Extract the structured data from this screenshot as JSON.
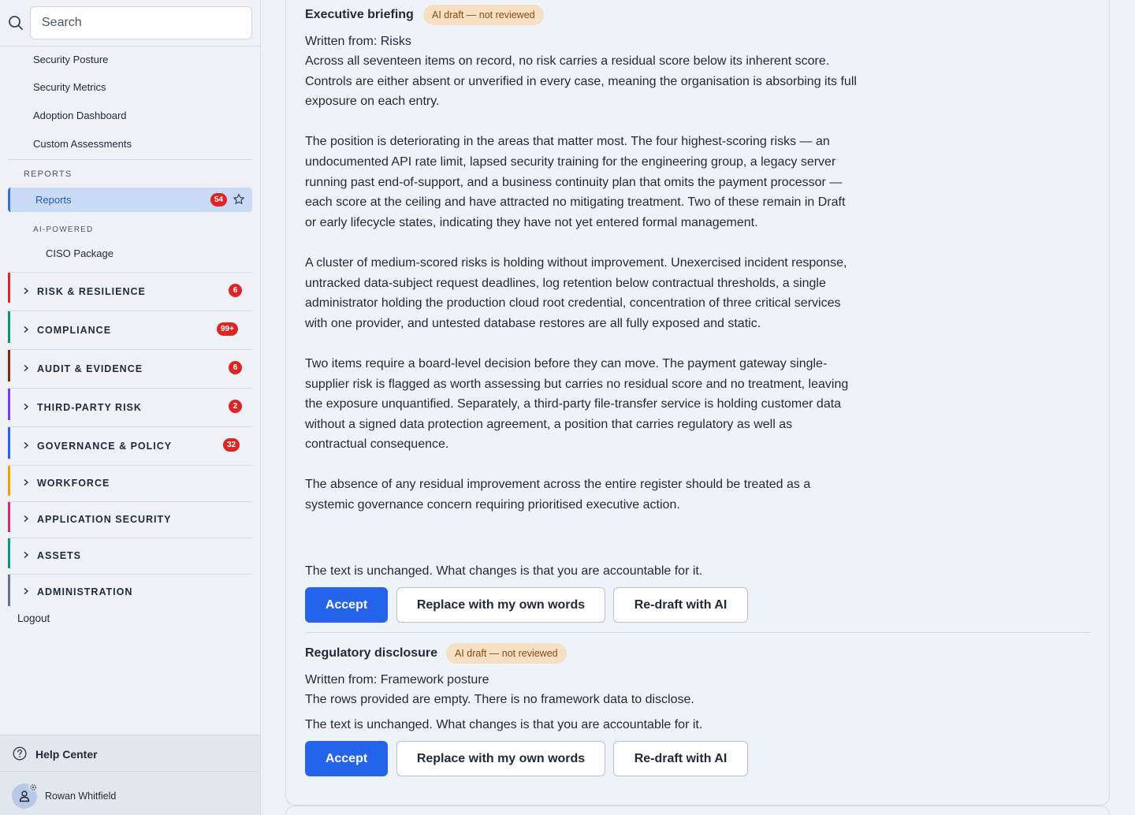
{
  "search": {
    "placeholder": "Search"
  },
  "nav_links": [
    "Security Posture",
    "Security Metrics",
    "Adoption Dashboard",
    "Custom Assessments"
  ],
  "reports_section": {
    "label": "REPORTS",
    "active_item": {
      "label": "Reports",
      "badge": "54"
    },
    "ai_label": "AI-POWERED",
    "ai_item": "CISO Package"
  },
  "groups": [
    {
      "label": "RISK & RESILIENCE",
      "badge": "6",
      "color": "#dc2626"
    },
    {
      "label": "COMPLIANCE",
      "badge": "99+",
      "color": "#059669"
    },
    {
      "label": "AUDIT & EVIDENCE",
      "badge": "6",
      "color": "#7c2d12"
    },
    {
      "label": "THIRD-PARTY RISK",
      "badge": "2",
      "color": "#7c3aed"
    },
    {
      "label": "GOVERNANCE & POLICY",
      "badge": "32",
      "color": "#2563eb"
    },
    {
      "label": "WORKFORCE",
      "badge": "",
      "color": "#f59e0b"
    },
    {
      "label": "APPLICATION SECURITY",
      "badge": "",
      "color": "#db2777"
    },
    {
      "label": "ASSETS",
      "badge": "",
      "color": "#0d9488"
    },
    {
      "label": "ADMINISTRATION",
      "badge": "",
      "color": "#64748b"
    }
  ],
  "logout": "Logout",
  "help_center": "Help Center",
  "user": {
    "name": "Rowan Whitfield"
  },
  "sections": [
    {
      "title": "Executive briefing",
      "chip": "AI draft — not reviewed",
      "written_from": "Written from: Risks",
      "paragraphs": [
        "Across all seventeen items on record, no risk carries a residual score below its inherent score. Controls are either absent or unverified in every case, meaning the organisation is absorbing its full exposure on each entry.",
        "The position is deteriorating in the areas that matter most. The four highest-scoring risks — an undocumented API rate limit, lapsed security training for the engineering group, a legacy server running past end-of-support, and a business continuity plan that omits the payment processor — each score at the ceiling and have attracted no mitigating treatment. Two of these remain in Draft or early lifecycle states, indicating they have not yet entered formal management.",
        "A cluster of medium-scored risks is holding without improvement. Unexercised incident response, untracked data-subject request deadlines, log retention below contractual thresholds, a single administrator holding the production cloud root credential, concentration of three critical services with one provider, and untested database restores are all fully exposed and static.",
        "Two items require a board-level decision before they can move. The payment gateway single-supplier risk is flagged as worth assessing but carries no residual score and no treatment, leaving the exposure unquantified. Separately, a third-party file-transfer service is holding customer data without a signed data protection agreement, a position that carries regulatory as well as contractual consequence.",
        "The absence of any residual improvement across the entire register should be treated as a systemic governance concern requiring prioritised executive action."
      ],
      "notice": "The text is unchanged. What changes is that you are accountable for it.",
      "accept": "Accept",
      "replace": "Replace with my own words",
      "redraft": "Re-draft with AI"
    },
    {
      "title": "Regulatory disclosure",
      "chip": "AI draft — not reviewed",
      "written_from": "Written from: Framework posture",
      "paragraphs": [
        "The rows provided are empty. There is no framework data to disclose."
      ],
      "notice": "The text is unchanged. What changes is that you are accountable for it.",
      "accept": "Accept",
      "replace": "Replace with my own words",
      "redraft": "Re-draft with AI"
    }
  ]
}
